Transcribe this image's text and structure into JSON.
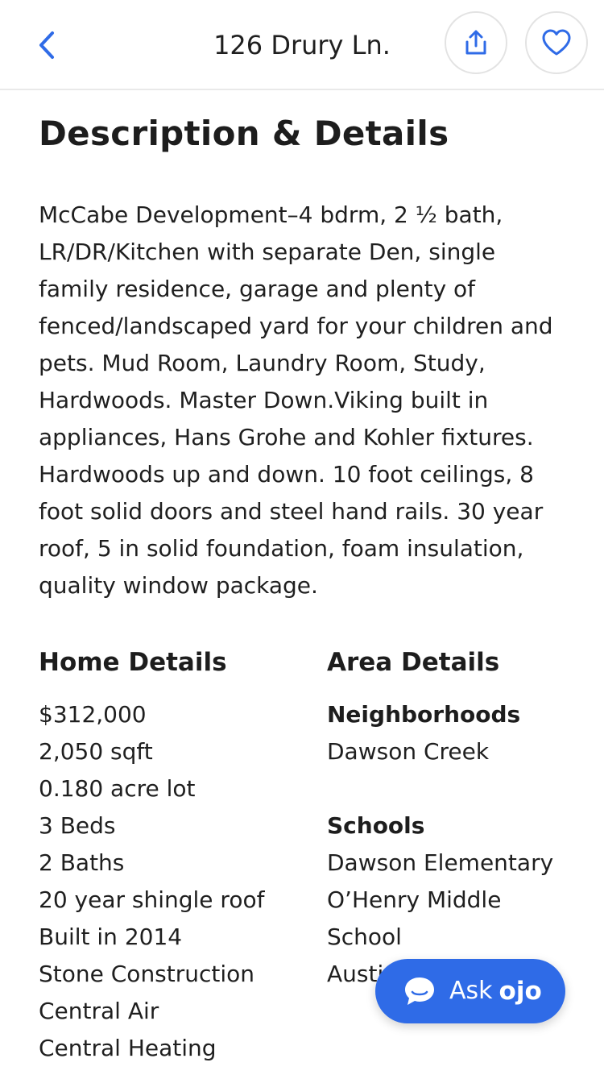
{
  "header": {
    "title": "126 Drury Ln.",
    "back_icon": "chevron-left-icon",
    "share_icon": "share-icon",
    "favorite_icon": "heart-icon",
    "accent": "#2f6be7"
  },
  "description": {
    "title": "Description & Details",
    "text": "McCabe Development–4 bdrm, 2 ½ bath, LR/DR/Kitchen with separate Den, single family residence, garage and plenty of fenced/landscaped yard for your children and pets. Mud Room, Laundry Room, Study, Hardwoods. Master Down.Viking built in appliances, Hans Grohe and Kohler fixtures. Hardwoods up and down. 10 foot ceilings, 8 foot solid doors and steel hand rails. 30 year roof, 5 in solid foundation, foam insulation, quality window package."
  },
  "home_details": {
    "heading": "Home Details",
    "items": [
      "$312,000",
      "2,050 sqft",
      "0.180 acre lot",
      "3 Beds",
      "2 Baths",
      "20 year shingle roof",
      "Built in 2014",
      "Stone Construction",
      "Central Air",
      "Central Heating"
    ]
  },
  "area_details": {
    "heading": "Area Details",
    "neighborhoods_label": "Neighborhoods",
    "neighborhood": "Dawson Creek",
    "schools_label": "Schools",
    "schools": [
      "Dawson Elementary",
      "O’Henry Middle",
      "School",
      "Austi"
    ]
  },
  "ask_button": {
    "label": "Ask",
    "brand": "ojo",
    "icon": "chat-bubble-icon",
    "color": "#2f6be7"
  }
}
